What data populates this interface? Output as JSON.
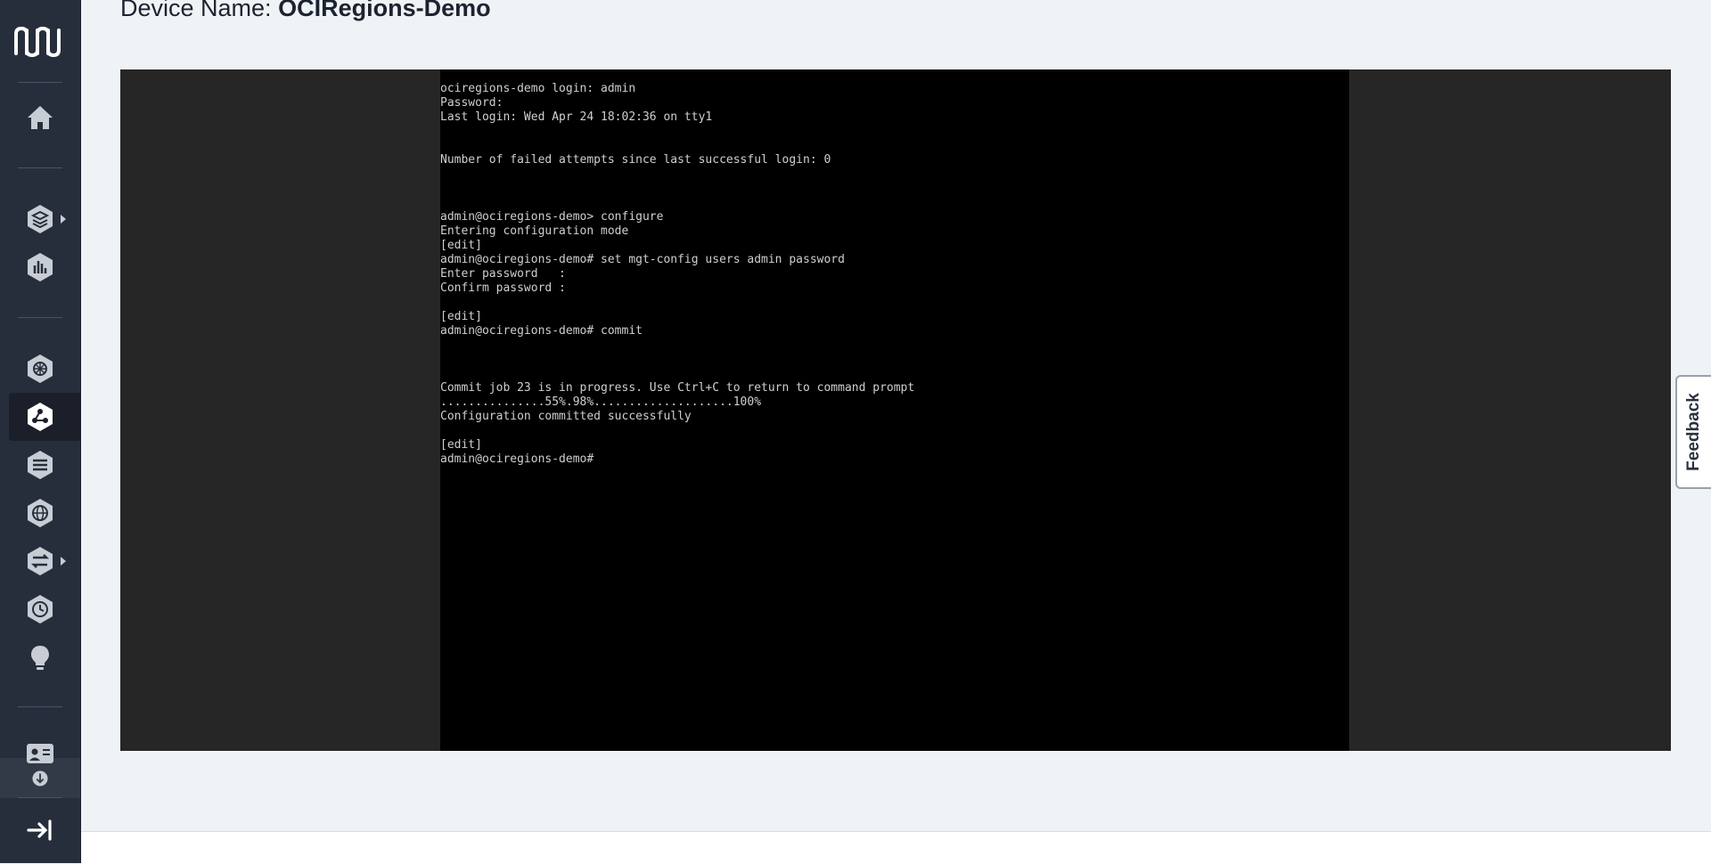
{
  "header": {
    "device_label": "Device Name:",
    "device_value": "OCIRegions-Demo"
  },
  "console": {
    "lines": [
      "ociregions-demo login: admin",
      "Password:",
      "Last login: Wed Apr 24 18:02:36 on tty1",
      "",
      "",
      "Number of failed attempts since last successful login: 0",
      "",
      "",
      "",
      "admin@ociregions-demo> configure",
      "Entering configuration mode",
      "[edit]",
      "admin@ociregions-demo# set mgt-config users admin password",
      "Enter password   :",
      "Confirm password :",
      "",
      "[edit]",
      "admin@ociregions-demo# commit",
      "",
      "",
      "",
      "Commit job 23 is in progress. Use Ctrl+C to return to command prompt",
      "...............55%.98%....................100%",
      "Configuration committed successfully",
      "",
      "[edit]",
      "admin@ociregions-demo#"
    ]
  },
  "feedback": {
    "label": "Feedback"
  },
  "sidebar": {
    "icons": [
      "logo-icon",
      "home-icon",
      "layers-icon",
      "analytics-icon",
      "network-icon",
      "connections-icon",
      "stack-icon",
      "globe-icon",
      "transfer-icon",
      "clock-icon",
      "lightbulb-icon",
      "contact-card-icon",
      "download-icon",
      "logout-icon"
    ]
  },
  "colors": {
    "sidebar_bg": "#272e3b",
    "page_bg": "#f0f3f6",
    "console_bg": "#000000",
    "console_frame": "#262626",
    "console_text": "#cfcfcf"
  }
}
